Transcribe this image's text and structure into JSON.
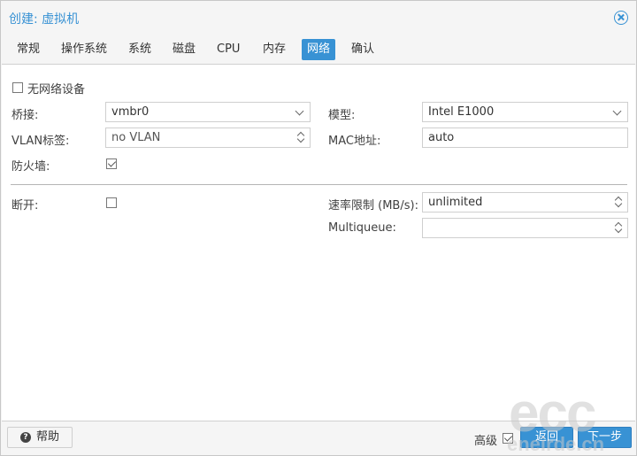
{
  "window": {
    "title": "创建: 虚拟机"
  },
  "tabs": [
    {
      "label": "常规",
      "active": false
    },
    {
      "label": "操作系统",
      "active": false
    },
    {
      "label": "系统",
      "active": false
    },
    {
      "label": "磁盘",
      "active": false
    },
    {
      "label": "CPU",
      "active": false
    },
    {
      "label": "内存",
      "active": false
    },
    {
      "label": "网络",
      "active": true
    },
    {
      "label": "确认",
      "active": false
    }
  ],
  "form": {
    "no_network_label": "无网络设备",
    "no_network_checked": false,
    "bridge_label": "桥接:",
    "bridge_value": "vmbr0",
    "vlan_label": "VLAN标签:",
    "vlan_value": "no VLAN",
    "firewall_label": "防火墙:",
    "firewall_checked": true,
    "model_label": "模型:",
    "model_value": "Intel E1000",
    "mac_label": "MAC地址:",
    "mac_value": "auto",
    "disconnect_label": "断开:",
    "disconnect_checked": false,
    "rate_limit_label": "速率限制 (MB/s):",
    "rate_limit_value": "unlimited",
    "multiqueue_label": "Multiqueue:",
    "multiqueue_value": ""
  },
  "footer": {
    "help_label": "帮助",
    "advanced_label": "高级",
    "advanced_checked": true,
    "back_label": "返回",
    "next_label": "下一步"
  },
  "watermark": {
    "big": "ecc",
    "small": "eneirde.cn"
  },
  "colors": {
    "accent": "#3892d4",
    "panel_bg": "#ffffff",
    "chrome_bg": "#f5f5f5"
  }
}
